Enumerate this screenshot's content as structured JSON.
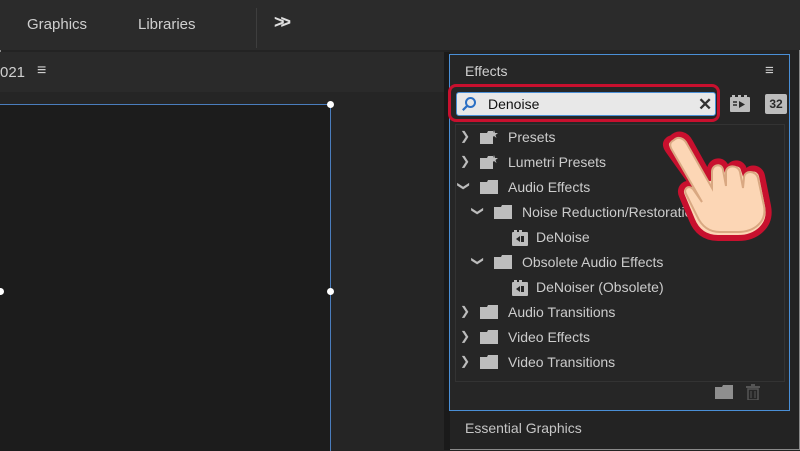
{
  "topbar": {
    "tabs": [
      "Graphics",
      "Libraries"
    ],
    "more_label": ">>"
  },
  "left_panel": {
    "title_fragment": "021",
    "menu_glyph": "≡"
  },
  "effects": {
    "title": "Effects",
    "menu_glyph": "≡",
    "search_value": "Denoise",
    "clear_glyph": "✕",
    "badge_32": "32",
    "tree": [
      {
        "label": "Presets",
        "expanded": false,
        "level": 0,
        "kind": "preset-folder"
      },
      {
        "label": "Lumetri Presets",
        "expanded": false,
        "level": 0,
        "kind": "preset-folder"
      },
      {
        "label": "Audio Effects",
        "expanded": true,
        "level": 0,
        "kind": "folder"
      },
      {
        "label": "Noise Reduction/Restoration",
        "expanded": true,
        "level": 1,
        "kind": "folder"
      },
      {
        "label": "DeNoise",
        "level": 2,
        "kind": "effect"
      },
      {
        "label": "Obsolete Audio Effects",
        "expanded": true,
        "level": 1,
        "kind": "folder"
      },
      {
        "label": "DeNoiser (Obsolete)",
        "level": 2,
        "kind": "effect"
      },
      {
        "label": "Audio Transitions",
        "expanded": false,
        "level": 0,
        "kind": "folder"
      },
      {
        "label": "Video Effects",
        "expanded": false,
        "level": 0,
        "kind": "folder"
      },
      {
        "label": "Video Transitions",
        "expanded": false,
        "level": 0,
        "kind": "folder"
      }
    ]
  },
  "essential_graphics": {
    "title": "Essential Graphics"
  },
  "colors": {
    "highlight": "#c8102e",
    "selection_border": "#4a8fd6",
    "hand_fill": "#fcd6b5"
  }
}
